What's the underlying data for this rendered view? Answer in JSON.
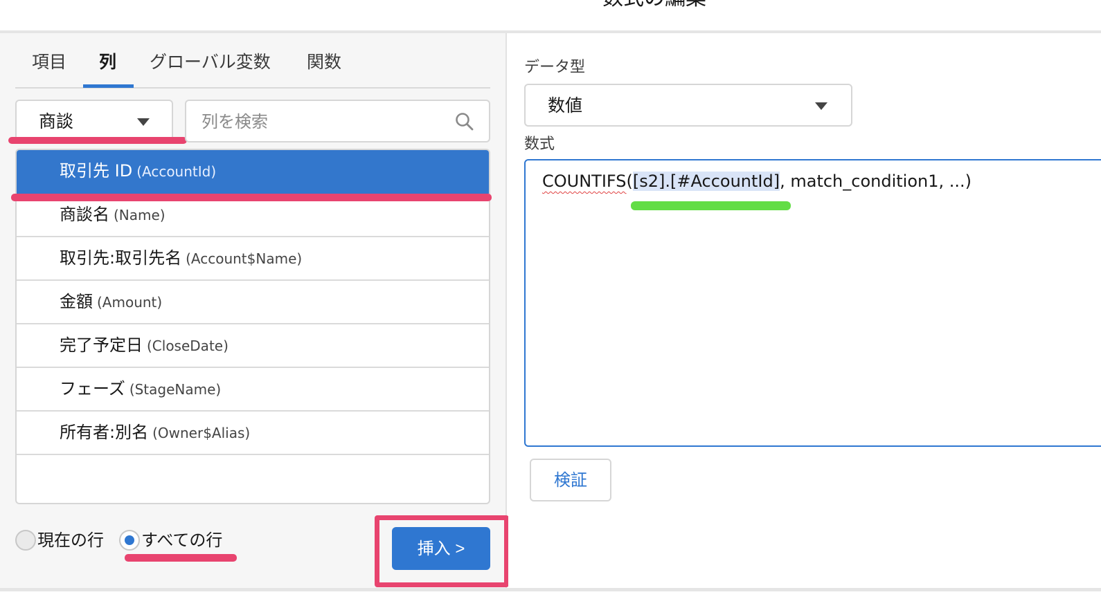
{
  "header": {
    "title": "数式の編集"
  },
  "tabs": [
    {
      "label": "項目",
      "active": false
    },
    {
      "label": "列",
      "active": true
    },
    {
      "label": "グローバル変数",
      "active": false
    },
    {
      "label": "関数",
      "active": false
    }
  ],
  "object_select": {
    "value": "商談"
  },
  "search": {
    "placeholder": "列を検索"
  },
  "columns": [
    {
      "label": "取引先 ID",
      "api": "(AccountId)",
      "selected": true
    },
    {
      "label": "商談名",
      "api": "(Name)",
      "selected": false
    },
    {
      "label": "取引先:取引先名",
      "api": "(Account$Name)",
      "selected": false
    },
    {
      "label": "金額",
      "api": "(Amount)",
      "selected": false
    },
    {
      "label": "完了予定日",
      "api": "(CloseDate)",
      "selected": false
    },
    {
      "label": "フェーズ",
      "api": "(StageName)",
      "selected": false
    },
    {
      "label": "所有者:別名",
      "api": "(Owner$Alias)",
      "selected": false
    }
  ],
  "scope": {
    "current_row_label": "現在の行",
    "all_rows_label": "すべての行",
    "selected": "all_rows"
  },
  "insert_button": {
    "label": "挿入 >"
  },
  "data_type": {
    "label": "データ型",
    "value": "数値"
  },
  "formula": {
    "label": "数式",
    "function_name": "COUNTIFS",
    "open_paren": "(",
    "selected_arg": "[s2].[#AccountId]",
    "rest": ", match_condition1, ...)"
  },
  "verify_button": {
    "label": "検証"
  },
  "colors": {
    "accent": "#2f77d1",
    "annotation_pink": "#e8446f",
    "annotation_green": "#62dd45"
  }
}
